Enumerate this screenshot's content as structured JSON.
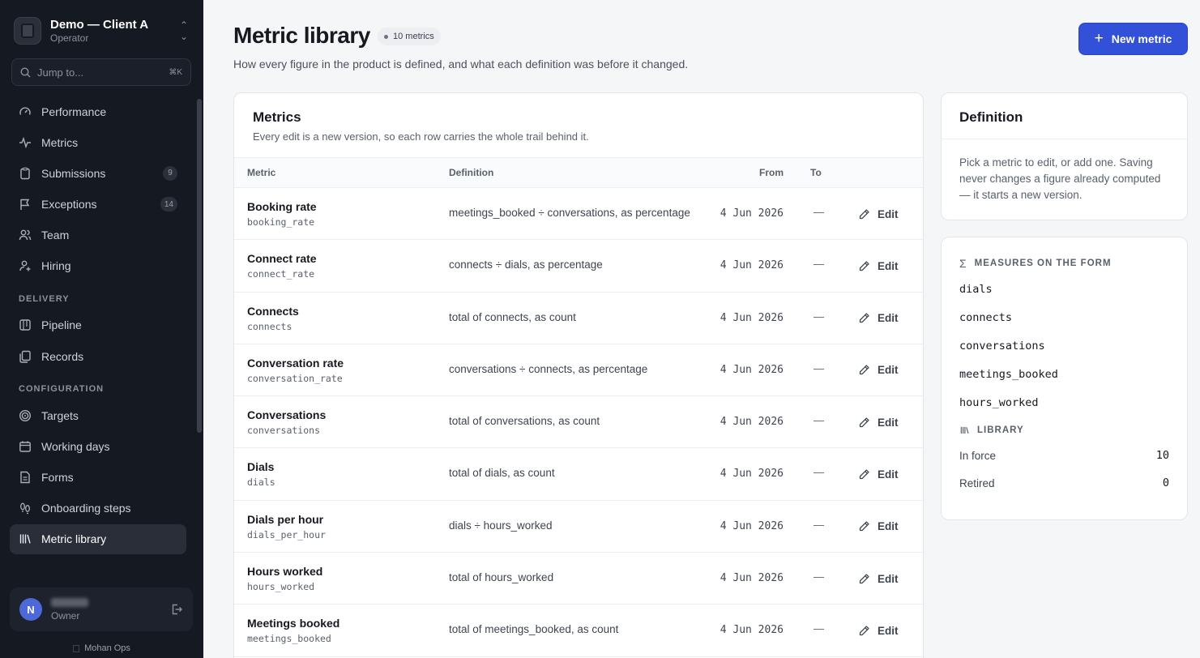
{
  "workspace": {
    "name": "Demo — Client A",
    "role": "Operator"
  },
  "search": {
    "placeholder": "Jump to...",
    "shortcut": "⌘K"
  },
  "nav": {
    "main": [
      {
        "label": "Performance",
        "icon": "gauge-icon",
        "badge": ""
      },
      {
        "label": "Metrics",
        "icon": "activity-icon",
        "badge": ""
      },
      {
        "label": "Submissions",
        "icon": "clipboard-icon",
        "badge": "9"
      },
      {
        "label": "Exceptions",
        "icon": "flag-icon",
        "badge": "14"
      },
      {
        "label": "Team",
        "icon": "users-icon",
        "badge": ""
      },
      {
        "label": "Hiring",
        "icon": "user-plus-icon",
        "badge": ""
      }
    ],
    "delivery_title": "DELIVERY",
    "delivery": [
      {
        "label": "Pipeline",
        "icon": "pipeline-icon"
      },
      {
        "label": "Records",
        "icon": "records-icon"
      }
    ],
    "config_title": "CONFIGURATION",
    "config": [
      {
        "label": "Targets",
        "icon": "target-icon"
      },
      {
        "label": "Working days",
        "icon": "calendar-icon"
      },
      {
        "label": "Forms",
        "icon": "form-icon"
      },
      {
        "label": "Onboarding steps",
        "icon": "footsteps-icon"
      },
      {
        "label": "Metric library",
        "icon": "library-icon"
      }
    ]
  },
  "user": {
    "initial": "N",
    "role": "Owner"
  },
  "footer": {
    "brand": "Mohan Ops"
  },
  "page": {
    "title": "Metric library",
    "count": "10 metrics",
    "subtitle": "How every figure in the product is defined, and what each definition was before it changed.",
    "new_button": "New metric"
  },
  "metrics_card": {
    "title": "Metrics",
    "subtitle": "Every edit is a new version, so each row carries the whole trail behind it.",
    "columns": {
      "metric": "Metric",
      "definition": "Definition",
      "from": "From",
      "to": "To"
    },
    "edit_label": "Edit",
    "rows": [
      {
        "name": "Booking rate",
        "key": "booking_rate",
        "definition": "meetings_booked ÷ conversations, as percentage",
        "from": "4 Jun 2026",
        "to": "—"
      },
      {
        "name": "Connect rate",
        "key": "connect_rate",
        "definition": "connects ÷ dials, as percentage",
        "from": "4 Jun 2026",
        "to": "—"
      },
      {
        "name": "Connects",
        "key": "connects",
        "definition": "total of connects, as count",
        "from": "4 Jun 2026",
        "to": "—"
      },
      {
        "name": "Conversation rate",
        "key": "conversation_rate",
        "definition": "conversations ÷ connects, as percentage",
        "from": "4 Jun 2026",
        "to": "—"
      },
      {
        "name": "Conversations",
        "key": "conversations",
        "definition": "total of conversations, as count",
        "from": "4 Jun 2026",
        "to": "—"
      },
      {
        "name": "Dials",
        "key": "dials",
        "definition": "total of dials, as count",
        "from": "4 Jun 2026",
        "to": "—"
      },
      {
        "name": "Dials per hour",
        "key": "dials_per_hour",
        "definition": "dials ÷ hours_worked",
        "from": "4 Jun 2026",
        "to": "—"
      },
      {
        "name": "Hours worked",
        "key": "hours_worked",
        "definition": "total of hours_worked",
        "from": "4 Jun 2026",
        "to": "—"
      },
      {
        "name": "Meetings booked",
        "key": "meetings_booked",
        "definition": "total of meetings_booked, as count",
        "from": "4 Jun 2026",
        "to": "—"
      }
    ]
  },
  "definition_card": {
    "title": "Definition",
    "body": "Pick a metric to edit, or add one. Saving never changes a figure already computed — it starts a new version."
  },
  "side_card": {
    "measures_title": "MEASURES ON THE FORM",
    "measures": [
      "dials",
      "connects",
      "conversations",
      "meetings_booked",
      "hours_worked"
    ],
    "library_title": "LIBRARY",
    "stats": [
      {
        "label": "In force",
        "value": "10"
      },
      {
        "label": "Retired",
        "value": "0"
      }
    ]
  },
  "colors": {
    "accent": "#3250d8",
    "sidebar": "#151922",
    "active_nav": "#2a2e38"
  }
}
